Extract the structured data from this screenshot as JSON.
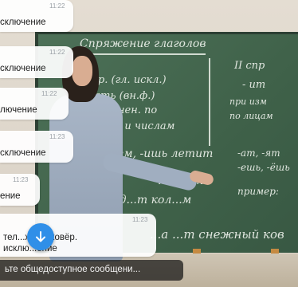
{
  "video": {
    "board_text": {
      "title": "Спряжение глаголов",
      "line1": "I спр. (гл. искл.)",
      "line2": "-ать (вн.ф.)",
      "line3": "изменен. по",
      "line4": "лицам и числам",
      "right1": "II спр",
      "right2": "- ит",
      "right3": "при изм",
      "right4": "по лицам",
      "mid1": "-ем, -ишь летит",
      "mid2": "-ат, -ят",
      "mid3": "-ешь, -ёшь",
      "mid4": "...ал...т",
      "mid5": "пример:",
      "mid6": "...ед...т  кол...м",
      "bottom": "...а ...т снежный ков"
    }
  },
  "chat": {
    "messages": [
      {
        "time": "11:22",
        "text": "сключение"
      },
      {
        "time": "11:22",
        "text": "сключение"
      },
      {
        "time": "11:22",
        "text": "лючение"
      },
      {
        "time": "11:23",
        "text": "сключение"
      },
      {
        "time": "11:23",
        "text": "ение"
      },
      {
        "time": "11:23",
        "line1": "тел...жный ковёр.",
        "line2": "исклю...ение"
      }
    ],
    "composer_placeholder": "ьте общедоступное сообщени...",
    "scroll_down_icon": "arrow-down-icon"
  },
  "colors": {
    "accent": "#2f8fe8",
    "board": "#44684f"
  }
}
